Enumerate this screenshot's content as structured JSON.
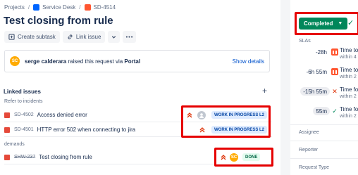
{
  "breadcrumb": {
    "projects": "Projects",
    "service_desk": "Service Desk",
    "issue_key": "SD-4514"
  },
  "issue": {
    "title": "Test closing from rule"
  },
  "toolbar": {
    "create_subtask": "Create subtask",
    "link_issue": "Link issue"
  },
  "reporter": {
    "initials": "SC",
    "name": "serge calderara",
    "action": " raised this request via ",
    "channel": "Portal",
    "show_details": "Show details"
  },
  "linked_issues": {
    "title": "Linked issues",
    "add": "+",
    "groups": [
      {
        "label": "Refer to incidents",
        "items": [
          {
            "key": "SD-4502",
            "summary": "Access denied error",
            "status": "WORK IN PROGRESS L2",
            "priority": "highest",
            "assignee": "unassigned"
          },
          {
            "key": "SD-4501",
            "summary": "HTTP error 502 when connecting to jira",
            "status": "WORK IN PROGRESS L2",
            "priority": "highest"
          }
        ]
      },
      {
        "label": "demands",
        "items": [
          {
            "key": "SHW-237",
            "summary": "Test closing from rule",
            "status": "DONE",
            "priority": "highest",
            "assignee_initials": "SC"
          }
        ]
      }
    ]
  },
  "side": {
    "status": "Completed",
    "slas_label": "SLAs",
    "slas": [
      {
        "time": "-28h",
        "state": "paused",
        "name": "Time to",
        "sub": "within 4"
      },
      {
        "time": "-6h 55m",
        "state": "paused",
        "name": "Time to",
        "sub": "within 2"
      },
      {
        "time": "-15h 55m",
        "state": "breached",
        "name": "Time for",
        "sub": "within 2"
      },
      {
        "time": "55m",
        "state": "met",
        "name": "Time fo",
        "sub": "within 2"
      }
    ],
    "fields": {
      "assignee": "Assignee",
      "reporter": "Reporter",
      "request_type": "Request Type"
    }
  },
  "colors": {
    "accent": "#0052cc",
    "completed": "#00875a",
    "highlight": "#e60000",
    "priority": "#de350b"
  }
}
